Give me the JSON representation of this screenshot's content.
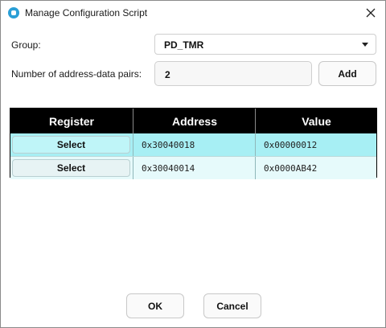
{
  "window": {
    "title": "Manage Configuration Script",
    "icon": "app-icon",
    "close_icon": "close-icon"
  },
  "form": {
    "group_label": "Group:",
    "group_value": "PD_TMR",
    "pairs_label": "Number of address-data pairs:",
    "pairs_value": "2",
    "add_label": "Add"
  },
  "table": {
    "headers": [
      "Register",
      "Address",
      "Value"
    ],
    "rows": [
      {
        "select_label": "Select",
        "address": "0x30040018",
        "value": "0x00000012"
      },
      {
        "select_label": "Select",
        "address": "0x30040014",
        "value": "0x0000AB42"
      }
    ]
  },
  "footer": {
    "ok_label": "OK",
    "cancel_label": "Cancel"
  },
  "colors": {
    "header_bg": "#000000",
    "row_selected_bg": "#a7eff4",
    "row_bg": "#e6fafb"
  }
}
